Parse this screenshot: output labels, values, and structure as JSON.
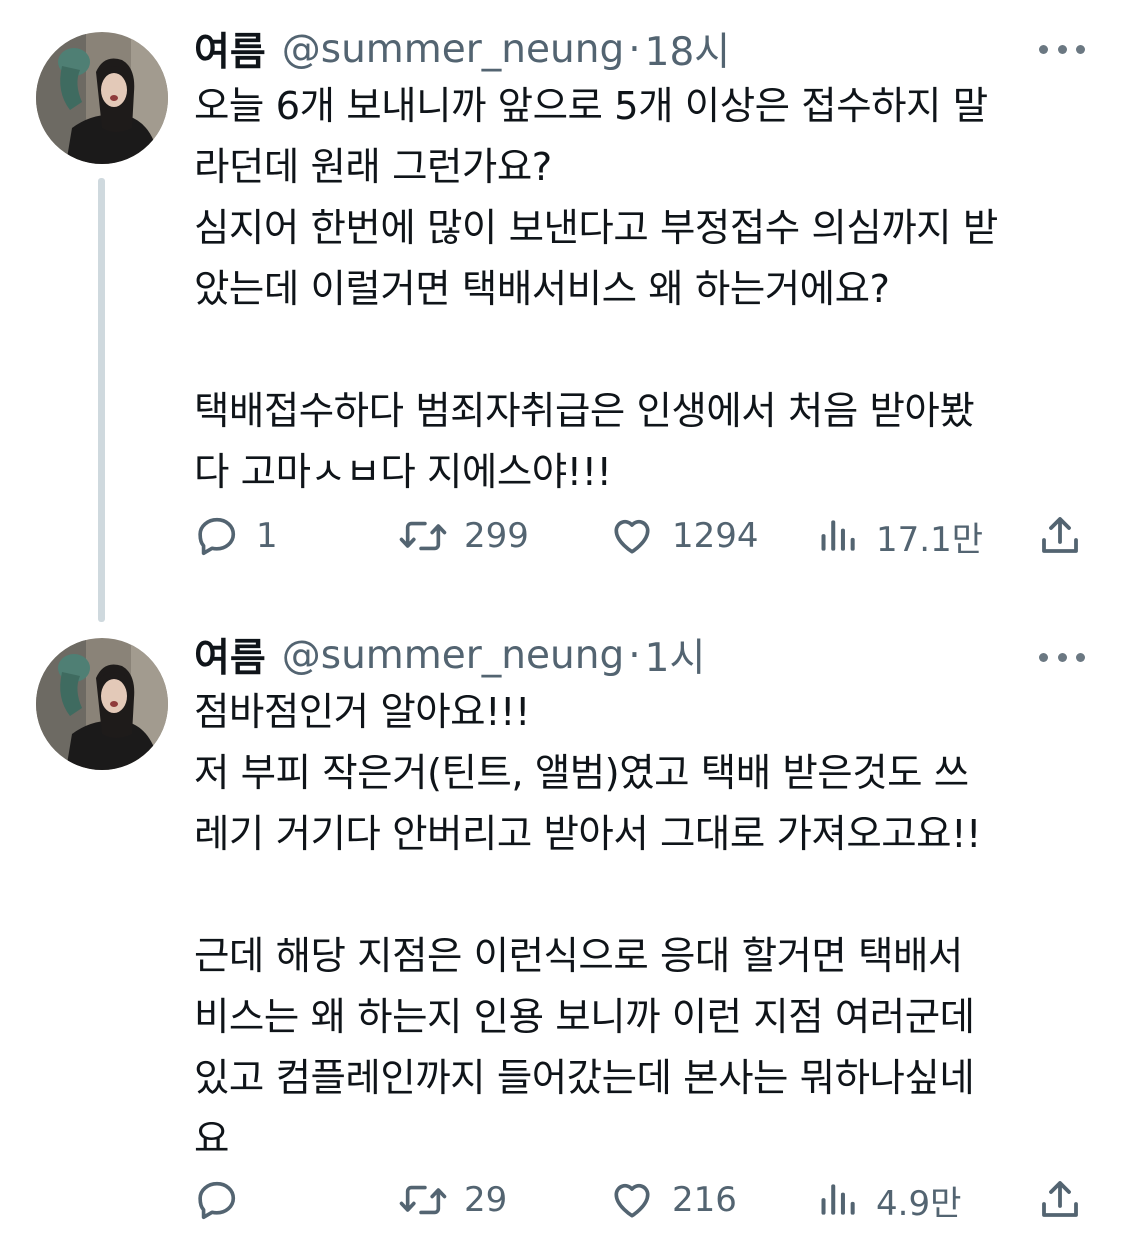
{
  "colors": {
    "text": "#0f1419",
    "secondary": "#536471",
    "thread_line": "#cfd9de"
  },
  "tweets": [
    {
      "display_name": "여름",
      "handle": "@summer_neung",
      "separator": "·",
      "time": "18시",
      "text": "오늘 6개 보내니까 앞으로 5개 이상은 접수하지 말\n라던데 원래 그런가요?\n심지어 한번에 많이 보낸다고 부정접수 의심까지 받\n았는데 이럴거면 택배서비스 왜 하는거에요?\n\n택배접수하다 범죄자취급은 인생에서 처음 받아봤\n다 고마ㅅㅂ다 지에스야!!!",
      "replies": "1",
      "retweets": "299",
      "likes": "1294",
      "views": "17.1만",
      "icons": [
        "reply-icon",
        "retweet-icon",
        "like-icon",
        "views-icon",
        "share-icon",
        "more-icon"
      ]
    },
    {
      "display_name": "여름",
      "handle": "@summer_neung",
      "separator": "·",
      "time": "1시",
      "text": "점바점인거 알아요!!!\n저 부피 작은거(틴트, 앨범)였고 택배 받은것도 쓰\n레기 거기다 안버리고 받아서 그대로 가져오고요!!\n\n근데 해당 지점은 이런식으로 응대 할거면 택배서\n비스는 왜 하는지 인용 보니까 이런 지점 여러군데\n있고 컴플레인까지 들어갔는데 본사는 뭐하나싶네\n요",
      "replies": "",
      "retweets": "29",
      "likes": "216",
      "views": "4.9만",
      "icons": [
        "reply-icon",
        "retweet-icon",
        "like-icon",
        "views-icon",
        "share-icon",
        "more-icon"
      ]
    }
  ]
}
